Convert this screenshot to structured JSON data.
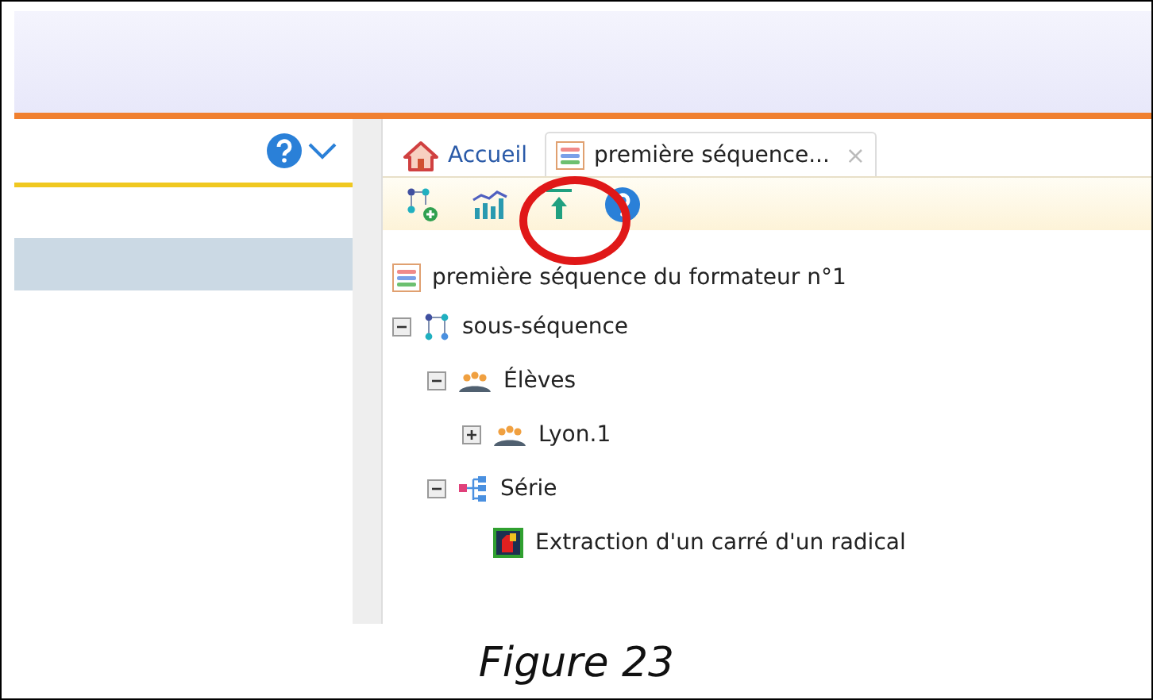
{
  "tabs": [
    {
      "label": "Accueil",
      "kind": "home",
      "selected": false
    },
    {
      "label": "première séquence...",
      "kind": "sequence",
      "selected": true,
      "close": "×"
    }
  ],
  "root": {
    "label": "première séquence du formateur n°1",
    "kind": "sequence"
  },
  "tree": [
    {
      "label": "sous-séquence",
      "kind": "subsequence",
      "expanded": true,
      "children": [
        {
          "label": "Élèves",
          "kind": "group",
          "expanded": true,
          "children": [
            {
              "label": "Lyon.1",
              "kind": "group",
              "expanded": false
            }
          ]
        },
        {
          "label": "Série",
          "kind": "series",
          "expanded": true,
          "children": [
            {
              "label": "Extraction d'un carré d'un radical",
              "kind": "exercise"
            }
          ]
        }
      ]
    }
  ],
  "caption": "Figure 23"
}
